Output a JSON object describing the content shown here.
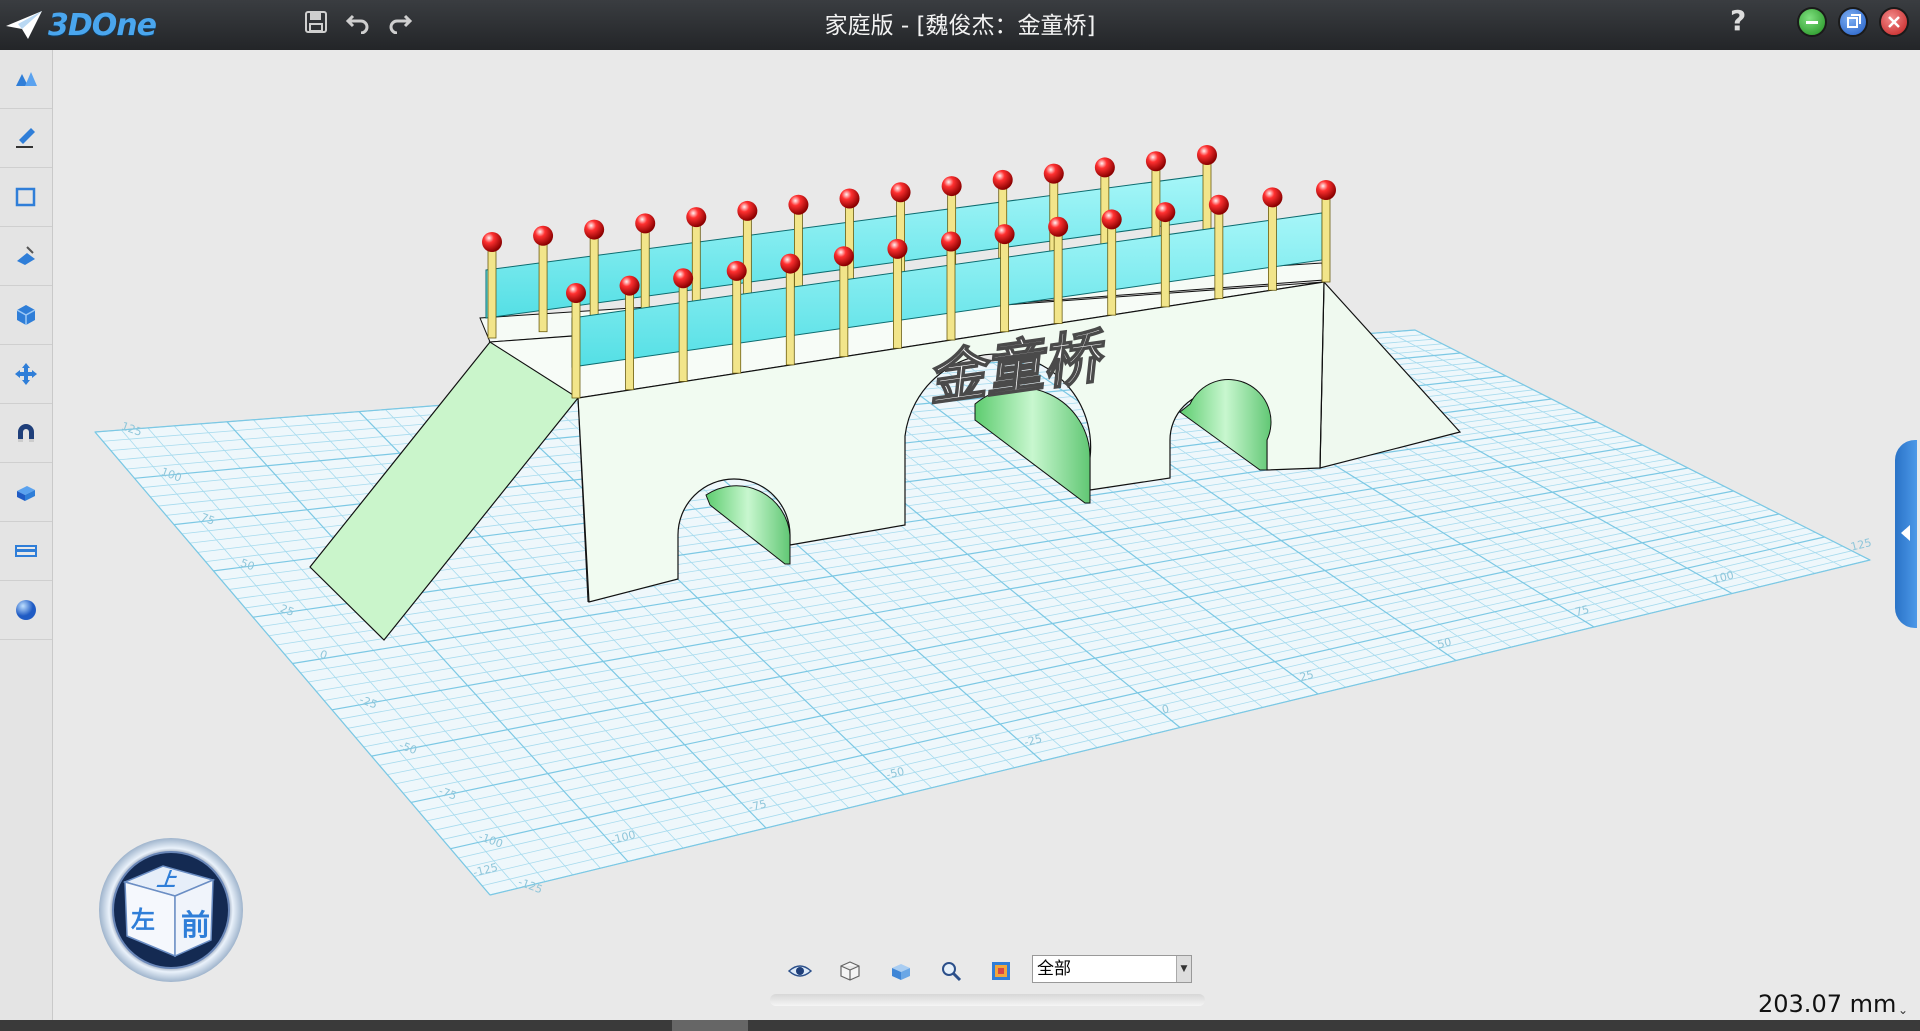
{
  "app": {
    "brand": "3DOne",
    "title": "家庭版 - [魏俊杰：金童桥]"
  },
  "titlebar": {
    "help_label": "?",
    "quick_actions": [
      "save-icon",
      "undo-icon",
      "redo-icon"
    ],
    "window_buttons": [
      {
        "name": "minimize",
        "color": "#2fa62f"
      },
      {
        "name": "restore",
        "color": "#2d6fd8"
      },
      {
        "name": "close",
        "color": "#d52b2b"
      }
    ]
  },
  "left_toolbar": {
    "tools": [
      "basic-solid-icon",
      "sketch-icon",
      "sketch-edit-icon",
      "feature-edit-icon",
      "special-function-icon",
      "basic-edit-icon",
      "combine-icon",
      "autosnap-icon",
      "distance-measure-icon",
      "material-render-icon"
    ]
  },
  "model": {
    "engraving": "金童桥"
  },
  "grid": {
    "major_ticks": [
      "-125",
      "-100",
      "-75",
      "-50",
      "-25",
      "0",
      "25",
      "50",
      "75",
      "100",
      "125"
    ]
  },
  "view_cube": {
    "top_label": "上",
    "front_label": "前",
    "left_label": "左"
  },
  "view_toolbar": {
    "icons": [
      "eye-icon",
      "wireframe-view-icon",
      "shaded-view-icon",
      "zoom-icon",
      "render-mode-icon"
    ],
    "filter": {
      "value": "全部"
    }
  },
  "status": {
    "measurement": "203.07 mm",
    "measurement_chevron": "⌄"
  },
  "colors": {
    "railing_cyan": "#7ff0f4",
    "post_yellow": "#f2e58a",
    "knob_red": "#e01414",
    "bridge_face": "#f1fbf1",
    "ramp_green": "#caf5cb",
    "grid_line": "#8fd3ea",
    "accent_blue": "#2a73c7"
  }
}
